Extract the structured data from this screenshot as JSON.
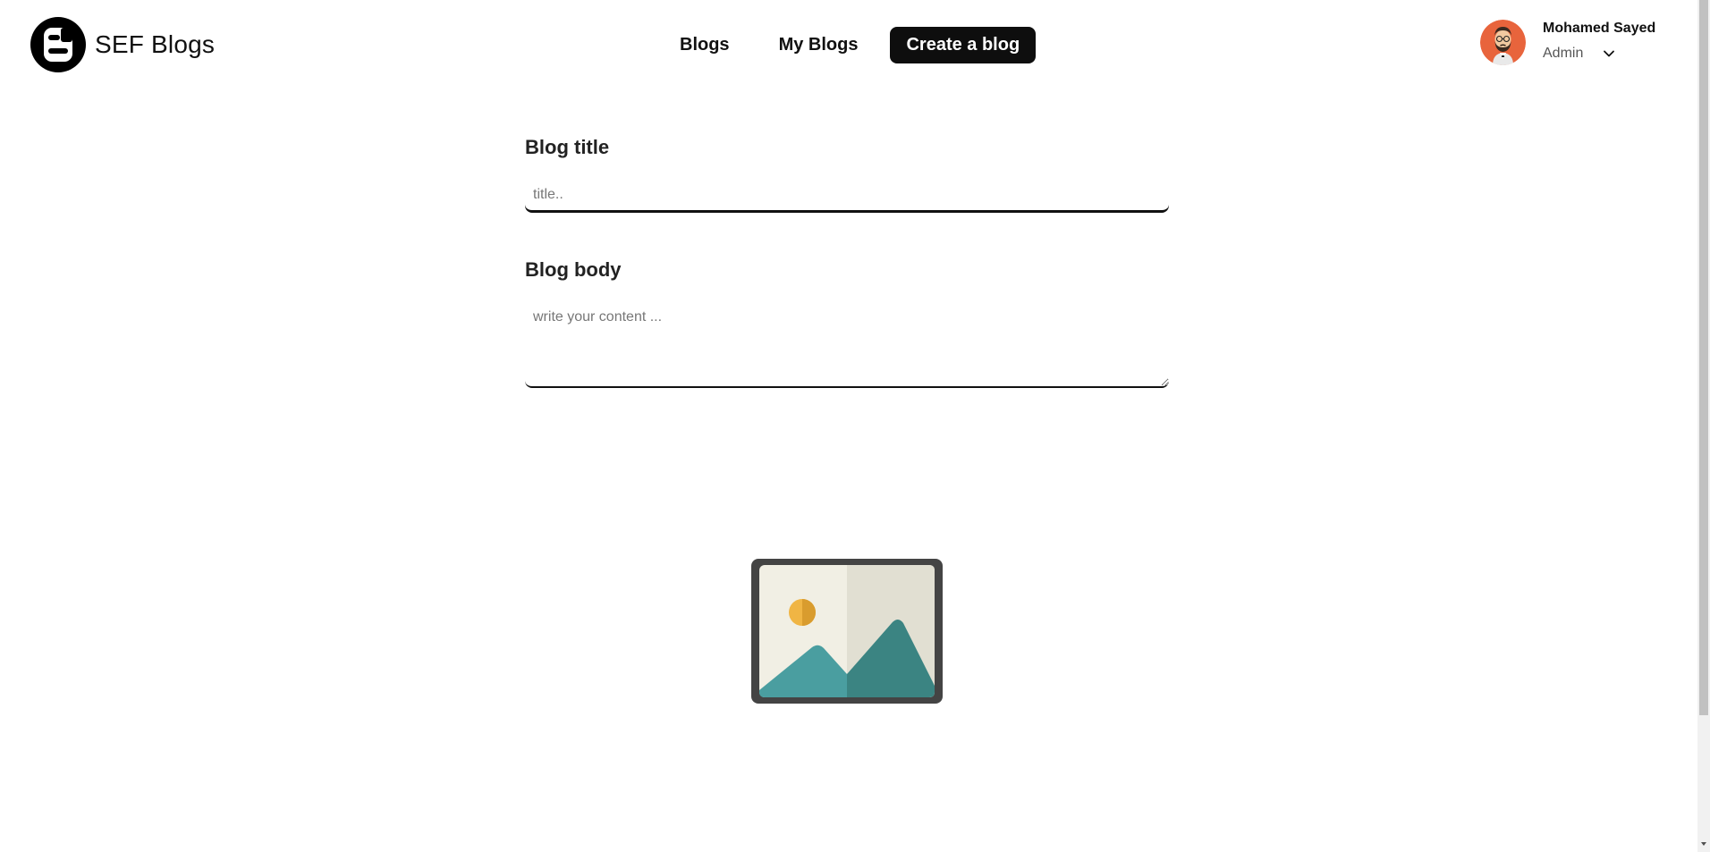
{
  "header": {
    "brand_name": "SEF Blogs",
    "nav": [
      {
        "label": "Blogs"
      },
      {
        "label": "My Blogs"
      }
    ],
    "create_label": "Create a blog",
    "user": {
      "name": "Mohamed Sayed",
      "role": "Admin"
    }
  },
  "form": {
    "title_label": "Blog title",
    "title_placeholder": "title..",
    "title_value": "",
    "body_label": "Blog body",
    "body_placeholder": "write your content ...",
    "body_value": ""
  },
  "icons": {
    "brand": "blogger-logo-icon",
    "avatar": "user-avatar",
    "chevron": "chevron-down-icon",
    "image_upload": "image-placeholder-icon"
  },
  "colors": {
    "primary": "#0e0e0e",
    "avatar_bg": "#e8643c",
    "image_teal": "#4a9ea0",
    "image_teal_dark": "#3b8482",
    "image_sun": "#f0b544",
    "image_frame": "#444444"
  }
}
